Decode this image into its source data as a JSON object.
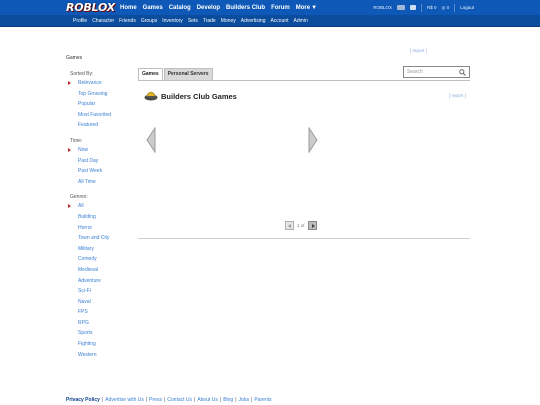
{
  "header": {
    "logo_text": "ROBLOX",
    "nav": [
      "Home",
      "Games",
      "Catalog",
      "Develop",
      "Builders Club",
      "Forum",
      "More"
    ],
    "username": "ROBLOX",
    "robux_count": "0",
    "tix_count": "0",
    "logout_label": "Logout"
  },
  "subnav": [
    "Profile",
    "Character",
    "Friends",
    "Groups",
    "Inventory",
    "Sets",
    "Trade",
    "Money",
    "Advertising",
    "Account",
    "Admin"
  ],
  "page": {
    "section_title": "Games",
    "report_top": "[ report ]",
    "report_mid": "[ report ]"
  },
  "sidebar": {
    "sorted_by_label": "Sorted By:",
    "sorts": [
      "Relevance",
      "Top Grossing",
      "Popular",
      "Most Favorited",
      "Featured"
    ],
    "time_label": "Time:",
    "times": [
      "Now",
      "Past Day",
      "Past Week",
      "All Time"
    ],
    "genres_label": "Genres:",
    "genres": [
      "All",
      "Building",
      "Horror",
      "Town and City",
      "Military",
      "Comedy",
      "Medieval",
      "Adventure",
      "Sci-Fi",
      "Naval",
      "FPS",
      "RPG",
      "Sports",
      "Fighting",
      "Western"
    ]
  },
  "tabs": [
    "Games",
    "Personal Servers"
  ],
  "search": {
    "placeholder": "Search"
  },
  "builders_club": {
    "title": "Builders Club Games"
  },
  "pager": {
    "info": "1 of"
  },
  "footer": {
    "links": [
      "Privacy Policy",
      "Advertise with Us",
      "Press",
      "Contact Us",
      "About Us",
      "Blog",
      "Jobs",
      "Parents"
    ]
  },
  "colors": {
    "topbar": "#0e59b8",
    "link": "#3a7fd5",
    "active_marker": "#c0292b"
  }
}
